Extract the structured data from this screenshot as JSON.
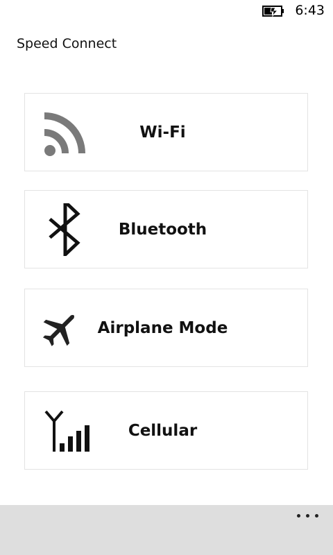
{
  "status_bar": {
    "time": "6:43",
    "battery_icon": "battery-charging-icon"
  },
  "app": {
    "title": "Speed Connect"
  },
  "tiles": [
    {
      "label": "Wi-Fi",
      "icon": "wifi-icon"
    },
    {
      "label": "Bluetooth",
      "icon": "bluetooth-icon"
    },
    {
      "label": "Airplane Mode",
      "icon": "airplane-icon"
    },
    {
      "label": "Cellular",
      "icon": "cellular-signal-icon"
    }
  ],
  "app_bar": {
    "more_icon": "ellipsis-icon"
  },
  "colors": {
    "background": "#ffffff",
    "tile_border": "#e3e3e3",
    "app_bar": "#dedede",
    "wifi_icon": "#7a7a7a",
    "icon_dark": "#111111"
  }
}
